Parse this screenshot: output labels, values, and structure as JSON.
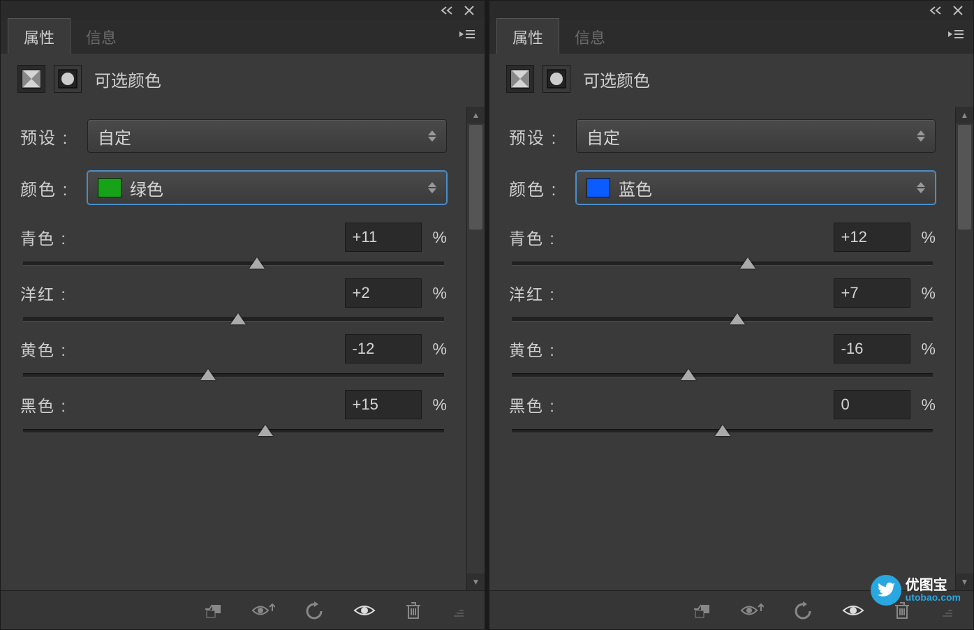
{
  "tabs": {
    "properties": "属性",
    "info": "信息"
  },
  "panel_title": "可选颜色",
  "labels": {
    "preset": "预设 :",
    "color": "颜色 :",
    "cyan": "青色 :",
    "magenta": "洋红 :",
    "yellow": "黄色 :",
    "black": "黑色 :",
    "pct": "%"
  },
  "panels": [
    {
      "preset_value": "自定",
      "color_name": "绿色",
      "color_swatch": "#17a317",
      "sliders": {
        "cyan": {
          "value": "+11",
          "percent": 55.5
        },
        "magenta": {
          "value": "+2",
          "percent": 51.0
        },
        "yellow": {
          "value": "-12",
          "percent": 44.0
        },
        "black": {
          "value": "+15",
          "percent": 57.5
        }
      }
    },
    {
      "preset_value": "自定",
      "color_name": "蓝色",
      "color_swatch": "#0a5cff",
      "sliders": {
        "cyan": {
          "value": "+12",
          "percent": 56.0
        },
        "magenta": {
          "value": "+7",
          "percent": 53.5
        },
        "yellow": {
          "value": "-16",
          "percent": 42.0
        },
        "black": {
          "value": "0",
          "percent": 50.0
        }
      }
    }
  ],
  "watermark": {
    "name": "优图宝",
    "url": "utobao.com"
  }
}
